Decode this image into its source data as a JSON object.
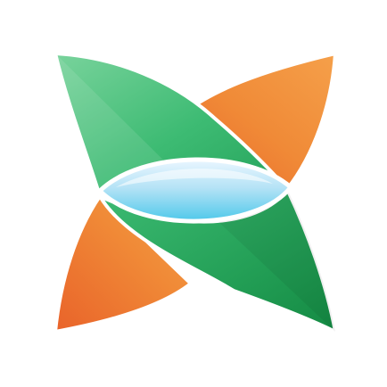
{
  "logo": {
    "name": "x-leaves-lens-logo",
    "background": "#ffffff",
    "colors": {
      "green_light": "#79d39c",
      "green_mid": "#3dbb73",
      "green_dark": "#148a43",
      "orange_light": "#f5a04a",
      "orange_mid": "#f08a37",
      "orange_dark": "#e9632a",
      "lens_top": "#eaf6ff",
      "lens_bottom": "#4ec8ea",
      "outline": "#ffffff"
    }
  }
}
